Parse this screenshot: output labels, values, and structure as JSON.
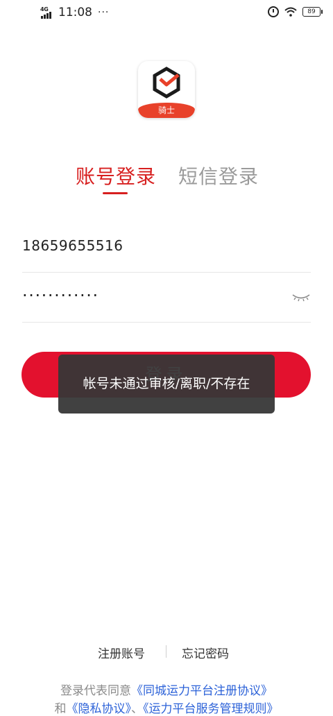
{
  "status_bar": {
    "network": "4G",
    "time": "11:08",
    "more": "···",
    "battery": "89"
  },
  "logo": {
    "badge_text": "骑士"
  },
  "tabs": {
    "account_login": "账号登录",
    "sms_login": "短信登录"
  },
  "form": {
    "phone_value": "18659655516",
    "password_value": "············"
  },
  "login_button_label": "登录",
  "toast_message": "帐号未通过审核/离职/不存在",
  "links": {
    "register": "注册账号",
    "forgot_password": "忘记密码"
  },
  "agreement": {
    "prefix": "登录代表同意",
    "registration_agreement": "《同城运力平台注册协议》",
    "and": "和",
    "privacy_agreement": "《隐私协议》",
    "separator": "、",
    "service_rules": "《运力平台服务管理规则》"
  },
  "colors": {
    "accent_red": "#e3112e",
    "tab_active": "#d71f1f",
    "logo_badge": "#e8412a",
    "link_blue": "#2c62d8"
  }
}
